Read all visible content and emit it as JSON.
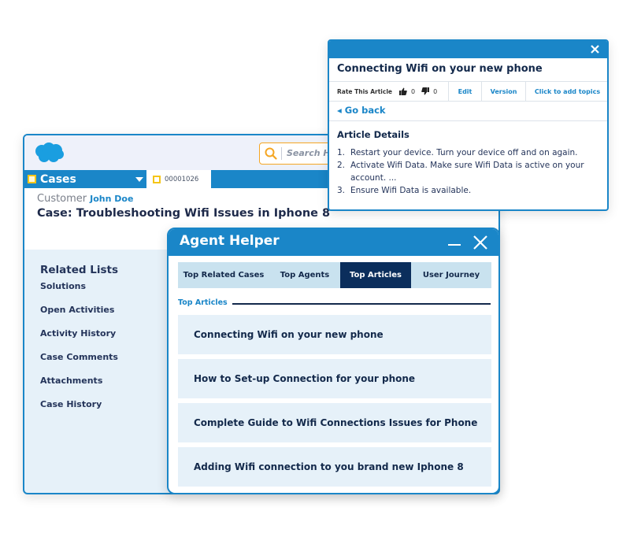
{
  "case_window": {
    "search_placeholder": "Search H",
    "nav_tab": "Cases",
    "record_tab": "00001026",
    "customer_label": "Customer",
    "customer_name": "John Doe",
    "case_title": "Case: Troubleshooting Wifi Issues in Iphone 8",
    "related_lists": {
      "title": "Related Lists",
      "items": [
        "Solutions",
        "Open Activities",
        "Activity History",
        "Case Comments",
        "Attachments",
        "Case History"
      ]
    }
  },
  "agent_helper": {
    "title": "Agent Helper",
    "tabs": [
      {
        "label": "Top Related Cases",
        "active": false
      },
      {
        "label": "Top Agents",
        "active": false
      },
      {
        "label": "Top Articles",
        "active": true
      },
      {
        "label": "User Journey",
        "active": false
      }
    ],
    "section_label": "Top Articles",
    "articles": [
      "Connecting Wifi on your new phone",
      "How to Set-up Connection for your phone",
      "Complete Guide to Wifi Connections Issues for Phone",
      "Adding Wifi connection to you brand new Iphone 8"
    ]
  },
  "article_popup": {
    "title": "Connecting Wifi on your new phone",
    "rate_label": "Rate This Article",
    "thumbs_up_count": "0",
    "thumbs_down_count": "0",
    "edit_label": "Edit",
    "version_label": "Version",
    "topics_label": "Click to add topics",
    "go_back_label": "◂ Go back",
    "details_title": "Article Details",
    "details": [
      {
        "num": "1.",
        "text": "Restart your device. Turn your device off and on again."
      },
      {
        "num": "2.",
        "text": "Activate Wifi Data. Make sure Wifi Data is active on your account. ..."
      },
      {
        "num": "3.",
        "text": "Ensure Wifi Data is available."
      }
    ]
  },
  "colors": {
    "brand_blue": "#1a86c8",
    "navy": "#13294b",
    "active_tab": "#0b2e5c",
    "search_accent": "#f5a623",
    "tab_icon": "#f5c518"
  }
}
